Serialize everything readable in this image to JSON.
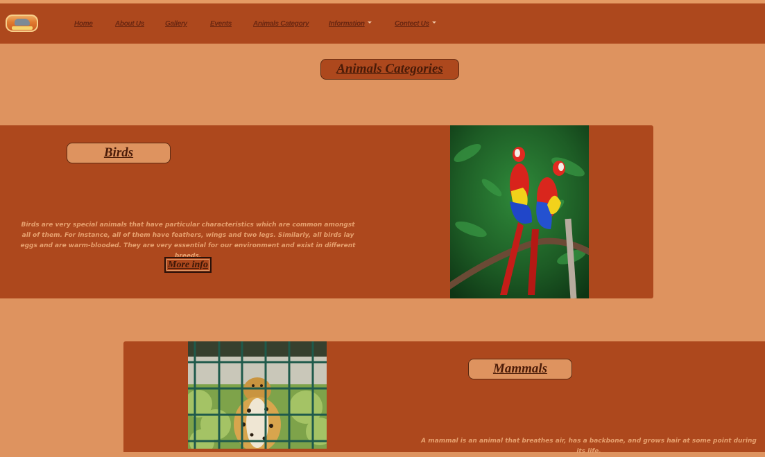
{
  "nav": {
    "logo_name": "zoo-logo",
    "links": [
      "Home",
      "About Us",
      "Gallery",
      "Events",
      "Animals Category",
      "Information",
      "Contect Us"
    ]
  },
  "page": {
    "title": "Animals Categories"
  },
  "birds": {
    "heading": "Birds",
    "description": "Birds are very special animals that have particular characteristics which are common amongst all of them. For instance, all of them have feathers, wings and two legs. Similarly, all birds lay eggs and are warm-blooded. They are very essential for our environment and exist in different breeds.",
    "more_label": "More info",
    "image": "scarlet-macaw-parrots"
  },
  "mammals": {
    "heading": "Mammals",
    "description": "A mammal is an animal that breathes air, has a backbone, and grows hair at some point during its life.",
    "image": "leopard-in-cage"
  },
  "colors": {
    "background": "#de935f",
    "accent": "#ad481d",
    "heading_text": "#4a1b08"
  }
}
